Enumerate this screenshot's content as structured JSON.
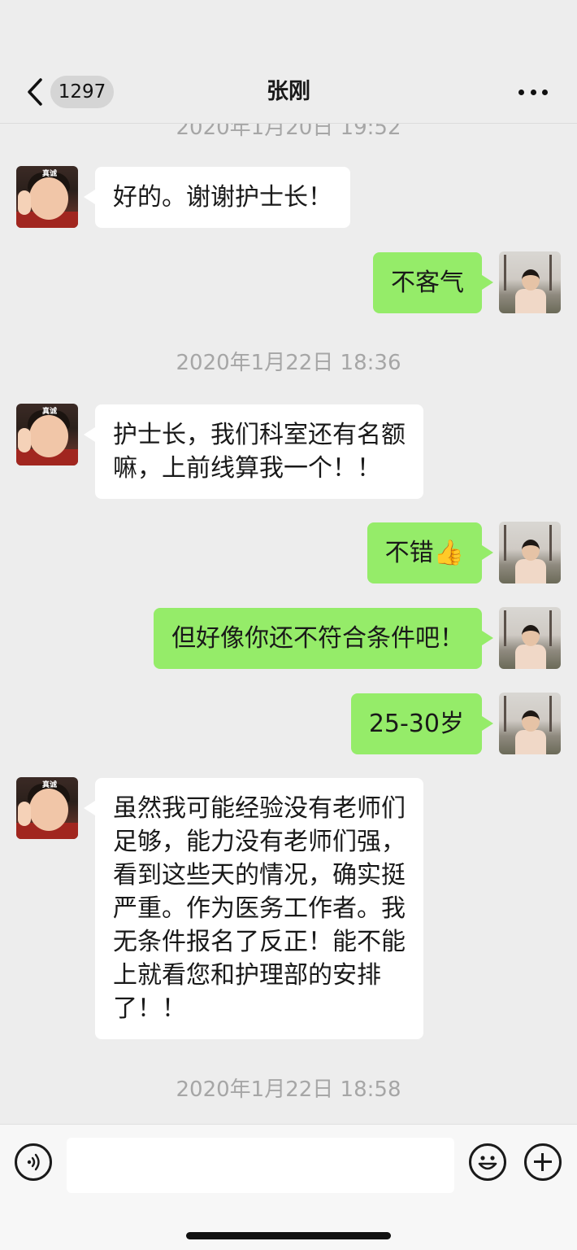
{
  "header": {
    "back_icon": "chevron-left-icon",
    "unread_count": "1297",
    "title": "张刚",
    "more_icon": "more-dots-icon"
  },
  "messages": [
    {
      "kind": "timestamp",
      "text": "2020年1月20日 19:52"
    },
    {
      "kind": "left",
      "text": "好的。谢谢护士长！"
    },
    {
      "kind": "right",
      "text": "不客气"
    },
    {
      "kind": "timestamp",
      "text": "2020年1月22日 18:36"
    },
    {
      "kind": "left",
      "text": "护士长，我们科室还有名额\n嘛，上前线算我一个！！"
    },
    {
      "kind": "right",
      "text": "不错👍"
    },
    {
      "kind": "right",
      "text": "但好像你还不符合条件吧！"
    },
    {
      "kind": "right",
      "text": "25-30岁"
    },
    {
      "kind": "left",
      "text": "虽然我可能经验没有老师们\n足够，能力没有老师们强，\n看到这些天的情况，确实挺\n严重。作为医务工作者。我\n无条件报名了反正！能不能\n上就看您和护理部的安排\n了！！"
    },
    {
      "kind": "timestamp",
      "text": "2020年1月22日 18:58"
    }
  ],
  "avatar_labels": {
    "contact": "真诚"
  },
  "input_bar": {
    "voice_icon": "voice-icon",
    "text_value": "",
    "emoji_icon": "emoji-icon",
    "plus_icon": "plus-icon"
  },
  "colors": {
    "background": "#ededed",
    "outgoing_bubble": "#95ec69",
    "incoming_bubble": "#ffffff",
    "timestamp": "#a6a6a6"
  }
}
